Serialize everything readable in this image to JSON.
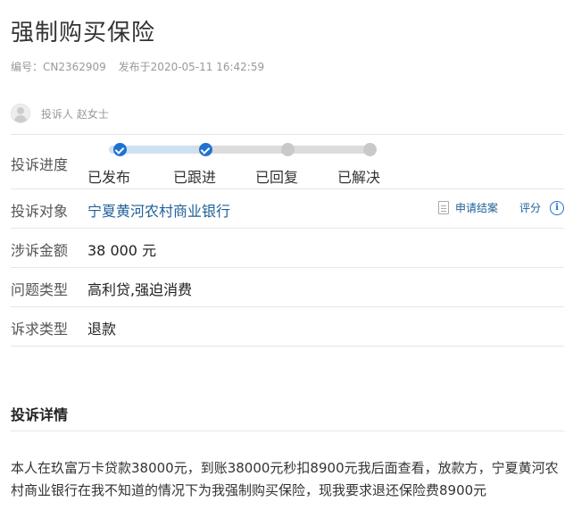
{
  "header": {
    "title": "强制购买保险",
    "id_label": "编号：",
    "id_value": "CN2362909",
    "published_label": "发布于",
    "published_value": "2020-05-11 16:42:59"
  },
  "complainant": {
    "text": "投诉人 赵女士"
  },
  "fields": {
    "progress": {
      "label": "投诉进度",
      "steps": [
        {
          "label": "已发布",
          "done": true
        },
        {
          "label": "已跟进",
          "done": true
        },
        {
          "label": "已回复",
          "done": false
        },
        {
          "label": "已解决",
          "done": false
        }
      ]
    },
    "target": {
      "label": "投诉对象",
      "value": "宁夏黄河农村商业银行"
    },
    "amount": {
      "label": "涉诉金额",
      "value": "38 000 元"
    },
    "issue_type": {
      "label": "问题类型",
      "value": "高利贷,强迫消费"
    },
    "demand_type": {
      "label": "诉求类型",
      "value": "退款"
    }
  },
  "actions": {
    "apply_close": "申请结案",
    "rate": "评分",
    "info_icon": "info-icon",
    "doc_icon": "document-icon"
  },
  "details": {
    "title": "投诉详情",
    "text": "本人在玖富万卡贷款38000元，到账38000元秒扣8900元我后面查看，放款方，宁夏黄河农村商业银行在我不知道的情况下为我强制购买保险，现我要求退还保险费8900元"
  }
}
